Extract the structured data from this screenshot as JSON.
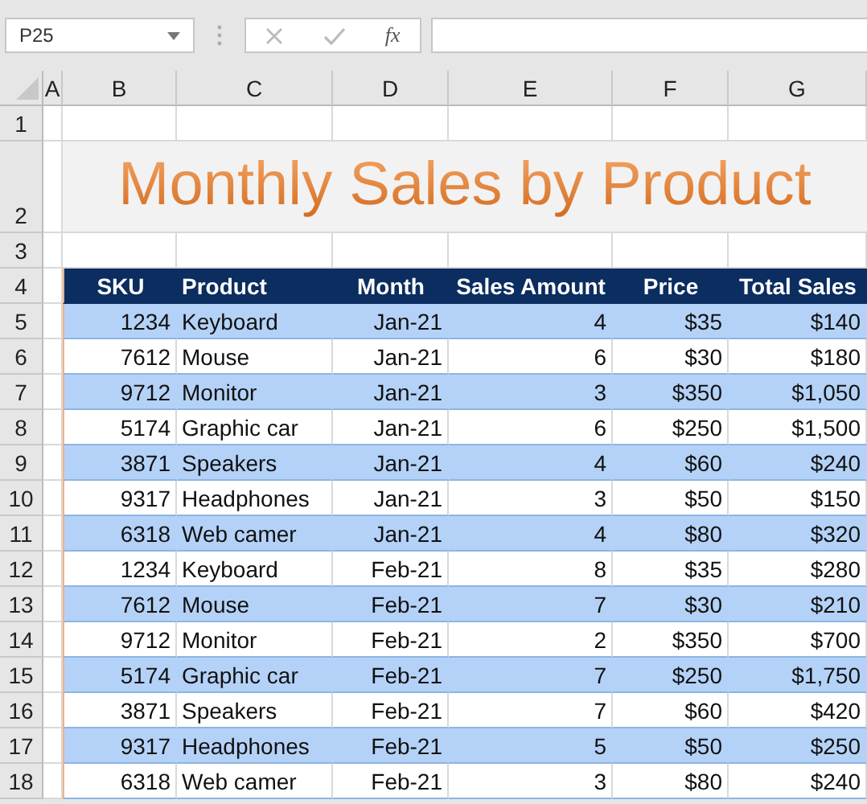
{
  "name_box": {
    "value": "P25"
  },
  "formula_bar": {
    "function_label": "fx"
  },
  "columns": [
    "A",
    "B",
    "C",
    "D",
    "E",
    "F",
    "G"
  ],
  "rows": [
    {
      "number": "1",
      "kind": "blank"
    },
    {
      "number": "2",
      "kind": "title",
      "title": "Monthly Sales by Product"
    },
    {
      "number": "3",
      "kind": "blank"
    },
    {
      "number": "4",
      "kind": "header",
      "cells": [
        "SKU",
        "Product",
        "Month",
        "Sales Amount",
        "Price",
        "Total Sales"
      ]
    },
    {
      "number": "5",
      "kind": "data",
      "shaded": true,
      "cells": [
        "1234",
        "Keyboard",
        "Jan-21",
        "4",
        "$35",
        "$140"
      ]
    },
    {
      "number": "6",
      "kind": "data",
      "shaded": false,
      "cells": [
        "7612",
        "Mouse",
        "Jan-21",
        "6",
        "$30",
        "$180"
      ]
    },
    {
      "number": "7",
      "kind": "data",
      "shaded": true,
      "cells": [
        "9712",
        "Monitor",
        "Jan-21",
        "3",
        "$350",
        "$1,050"
      ]
    },
    {
      "number": "8",
      "kind": "data",
      "shaded": false,
      "cells": [
        "5174",
        "Graphic car",
        "Jan-21",
        "6",
        "$250",
        "$1,500"
      ]
    },
    {
      "number": "9",
      "kind": "data",
      "shaded": true,
      "cells": [
        "3871",
        "Speakers",
        "Jan-21",
        "4",
        "$60",
        "$240"
      ]
    },
    {
      "number": "10",
      "kind": "data",
      "shaded": false,
      "cells": [
        "9317",
        "Headphones",
        "Jan-21",
        "3",
        "$50",
        "$150"
      ]
    },
    {
      "number": "11",
      "kind": "data",
      "shaded": true,
      "cells": [
        "6318",
        "Web camer",
        "Jan-21",
        "4",
        "$80",
        "$320"
      ]
    },
    {
      "number": "12",
      "kind": "data",
      "shaded": false,
      "cells": [
        "1234",
        "Keyboard",
        "Feb-21",
        "8",
        "$35",
        "$280"
      ]
    },
    {
      "number": "13",
      "kind": "data",
      "shaded": true,
      "cells": [
        "7612",
        "Mouse",
        "Feb-21",
        "7",
        "$30",
        "$210"
      ]
    },
    {
      "number": "14",
      "kind": "data",
      "shaded": false,
      "cells": [
        "9712",
        "Monitor",
        "Feb-21",
        "2",
        "$350",
        "$700"
      ]
    },
    {
      "number": "15",
      "kind": "data",
      "shaded": true,
      "cells": [
        "5174",
        "Graphic car",
        "Feb-21",
        "7",
        "$250",
        "$1,750"
      ]
    },
    {
      "number": "16",
      "kind": "data",
      "shaded": false,
      "cells": [
        "3871",
        "Speakers",
        "Feb-21",
        "7",
        "$60",
        "$420"
      ]
    },
    {
      "number": "17",
      "kind": "data",
      "shaded": true,
      "cells": [
        "9317",
        "Headphones",
        "Feb-21",
        "5",
        "$50",
        "$250"
      ]
    },
    {
      "number": "18",
      "kind": "data",
      "shaded": false,
      "cells": [
        "6318",
        "Web camer",
        "Feb-21",
        "3",
        "$80",
        "$240"
      ]
    }
  ]
}
